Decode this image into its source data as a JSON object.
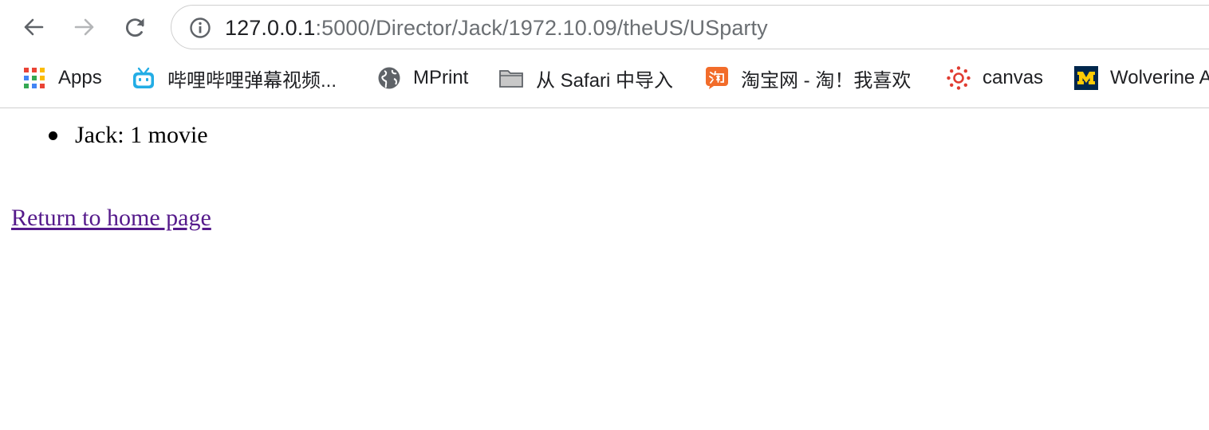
{
  "browser": {
    "url_host": "127.0.0.1",
    "url_path": ":5000/Director/Jack/1972.10.09/theUS/USparty",
    "nav": {
      "back_icon": "arrow-left-icon",
      "forward_icon": "arrow-right-icon",
      "reload_icon": "reload-icon",
      "info_icon": "info-icon"
    },
    "bookmarks": [
      {
        "label": "Apps",
        "icon": "apps-grid-icon"
      },
      {
        "label": "哔哩哔哩弹幕视频...",
        "icon": "bilibili-tv-icon"
      },
      {
        "label": "MPrint",
        "icon": "globe-icon"
      },
      {
        "label": "从 Safari 中导入",
        "icon": "folder-icon"
      },
      {
        "label": "淘宝网 - 淘！我喜欢",
        "icon": "taobao-icon"
      },
      {
        "label": "canvas",
        "icon": "canvas-icon"
      },
      {
        "label": "Wolverine A",
        "icon": "michigan-m-icon"
      }
    ]
  },
  "page": {
    "list_items": [
      "Jack: 1 movie"
    ],
    "home_link": "Return to home page",
    "link_color": "#551a8b"
  }
}
